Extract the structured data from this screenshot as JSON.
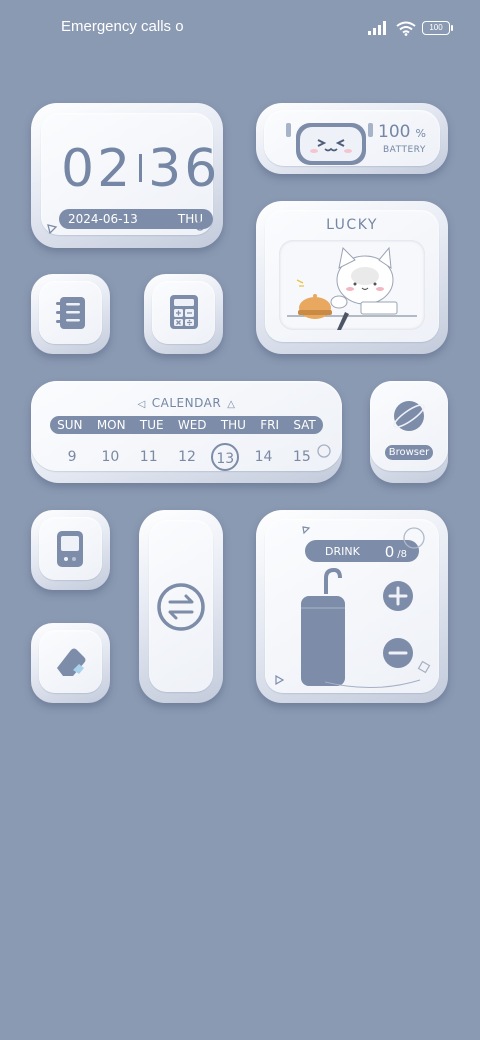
{
  "status": {
    "carrier_text": "Emergency calls o",
    "battery_level": "100"
  },
  "clock": {
    "hours": "02",
    "minutes": "36",
    "date": "2024-06-13",
    "weekday": "THU"
  },
  "battery_widget": {
    "percent": "100",
    "unit": "%",
    "label": "BATTERY"
  },
  "lucky_widget": {
    "title": "LUCKY"
  },
  "calendar": {
    "title": "CALENDAR",
    "days": [
      "SUN",
      "MON",
      "TUE",
      "WED",
      "THU",
      "FRI",
      "SAT"
    ],
    "dates": [
      "9",
      "10",
      "11",
      "12",
      "13",
      "14",
      "15"
    ],
    "today_index": 4
  },
  "browser": {
    "label": "Browser"
  },
  "drink": {
    "label": "DRINK",
    "count": "0",
    "goal": "/8"
  },
  "colors": {
    "background": "#8b9ab3",
    "accent": "#7d8ca8",
    "widget_face": "#eef1f7"
  },
  "icons": [
    "signal-icon",
    "wifi-icon",
    "battery-icon",
    "notes-list-icon",
    "calculator-icon",
    "globe-icon",
    "phone-device-icon",
    "transfer-arrows-icon",
    "eraser-icon",
    "plus-icon",
    "minus-icon"
  ]
}
